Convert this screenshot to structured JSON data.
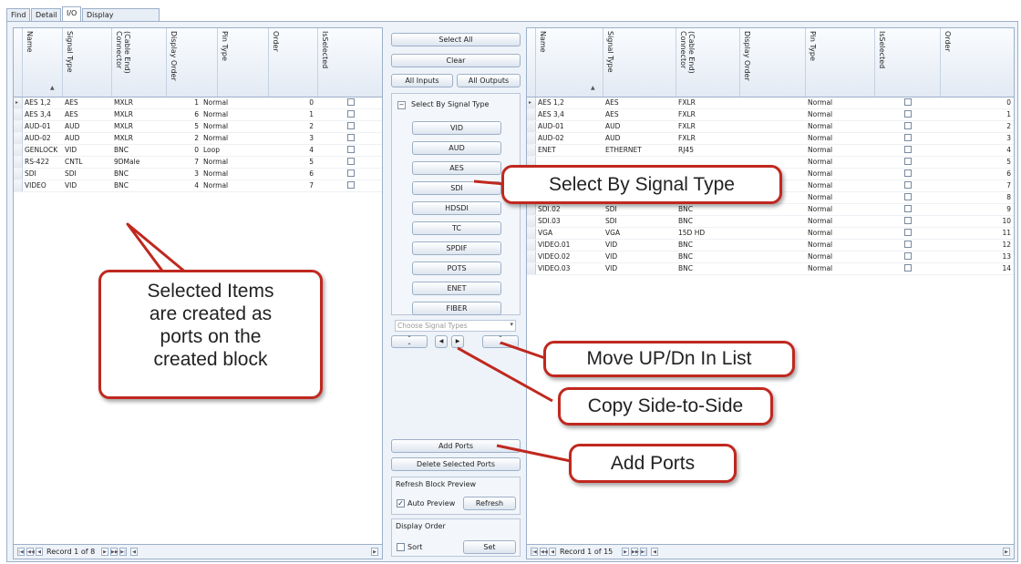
{
  "tabs": [
    "Find",
    "Detail",
    "I/O",
    "Display Preferences"
  ],
  "active_tab": "I/O",
  "left_grid": {
    "columns": [
      "Name",
      "Signal Type",
      "(Cable End)\nConnector",
      "Display Order",
      "Pin Type",
      "Order",
      "IsSelected"
    ],
    "rows": [
      {
        "name": "AES 1,2",
        "signal": "AES",
        "connector": "MXLR",
        "display_order": "1",
        "pin_type": "Normal",
        "order": "0"
      },
      {
        "name": "AES 3,4",
        "signal": "AES",
        "connector": "MXLR",
        "display_order": "6",
        "pin_type": "Normal",
        "order": "1"
      },
      {
        "name": "AUD-01",
        "signal": "AUD",
        "connector": "MXLR",
        "display_order": "5",
        "pin_type": "Normal",
        "order": "2"
      },
      {
        "name": "AUD-02",
        "signal": "AUD",
        "connector": "MXLR",
        "display_order": "2",
        "pin_type": "Normal",
        "order": "3"
      },
      {
        "name": "GENLOCK",
        "signal": "VID",
        "connector": "BNC",
        "display_order": "0",
        "pin_type": "Loop",
        "order": "4"
      },
      {
        "name": "RS-422",
        "signal": "CNTL",
        "connector": "9DMale",
        "display_order": "7",
        "pin_type": "Normal",
        "order": "5"
      },
      {
        "name": "SDI",
        "signal": "SDI",
        "connector": "BNC",
        "display_order": "3",
        "pin_type": "Normal",
        "order": "6"
      },
      {
        "name": "VIDEO",
        "signal": "VID",
        "connector": "BNC",
        "display_order": "4",
        "pin_type": "Normal",
        "order": "7"
      }
    ],
    "record_text": "Record 1 of 8"
  },
  "right_grid": {
    "columns": [
      "Name",
      "Signal Type",
      "(Cable End)\nConnector",
      "Display Order",
      "Pin Type",
      "IsSelected",
      "Order"
    ],
    "rows": [
      {
        "name": "AES 1,2",
        "signal": "AES",
        "connector": "FXLR",
        "pin_type": "Normal",
        "order": "0"
      },
      {
        "name": "AES 3,4",
        "signal": "AES",
        "connector": "FXLR",
        "pin_type": "Normal",
        "order": "1"
      },
      {
        "name": "AUD-01",
        "signal": "AUD",
        "connector": "FXLR",
        "pin_type": "Normal",
        "order": "2"
      },
      {
        "name": "AUD-02",
        "signal": "AUD",
        "connector": "FXLR",
        "pin_type": "Normal",
        "order": "3"
      },
      {
        "name": "ENET",
        "signal": "ETHERNET",
        "connector": "RJ45",
        "pin_type": "Normal",
        "order": "4"
      },
      {
        "name": "",
        "signal": "",
        "connector": "",
        "pin_type": "Normal",
        "order": "5"
      },
      {
        "name": "",
        "signal": "",
        "connector": "",
        "pin_type": "Normal",
        "order": "6"
      },
      {
        "name": "",
        "signal": "",
        "connector": "",
        "pin_type": "Normal",
        "order": "7"
      },
      {
        "name": "SDI.01",
        "signal": "SDI",
        "connector": "BNC",
        "pin_type": "Normal",
        "order": "8"
      },
      {
        "name": "SDI.02",
        "signal": "SDI",
        "connector": "BNC",
        "pin_type": "Normal",
        "order": "9"
      },
      {
        "name": "SDI.03",
        "signal": "SDI",
        "connector": "BNC",
        "pin_type": "Normal",
        "order": "10"
      },
      {
        "name": "VGA",
        "signal": "VGA",
        "connector": "15D HD",
        "pin_type": "Normal",
        "order": "11"
      },
      {
        "name": "VIDEO.01",
        "signal": "VID",
        "connector": "BNC",
        "pin_type": "Normal",
        "order": "12"
      },
      {
        "name": "VIDEO.02",
        "signal": "VID",
        "connector": "BNC",
        "pin_type": "Normal",
        "order": "13"
      },
      {
        "name": "VIDEO.03",
        "signal": "VID",
        "connector": "BNC",
        "pin_type": "Normal",
        "order": "14"
      }
    ],
    "record_text": "Record 1 of 15"
  },
  "middle": {
    "select_all": "Select All",
    "clear": "Clear",
    "all_inputs": "All Inputs",
    "all_outputs": "All Outputs",
    "select_by_signal_type": "Select By Signal Type",
    "signal_types": [
      "VID",
      "AUD",
      "AES",
      "SDI",
      "HDSDI",
      "TC",
      "SPDIF",
      "POTS",
      "ENET",
      "FIBER"
    ],
    "choose_placeholder": "Choose Signal Types",
    "add_ports": "Add Ports",
    "delete_selected_ports": "Delete Selected Ports",
    "refresh_block_preview": "Refresh Block Preview",
    "auto_preview": "Auto Preview",
    "auto_preview_checked": true,
    "refresh": "Refresh",
    "display_order": "Display Order",
    "sort": "Sort",
    "set": "Set"
  },
  "callouts": {
    "selected_items": "Selected Items\nare created as\nports on the\ncreated block",
    "select_by_signal_type": "Select By Signal Type",
    "move_up_dn": "Move UP/Dn In List",
    "copy_side": "Copy Side-to-Side",
    "add_ports": "Add Ports"
  },
  "colors": {
    "callout_border": "#c0281f",
    "panel_bg": "#eef3f9",
    "grid_border": "#9db0c8"
  }
}
